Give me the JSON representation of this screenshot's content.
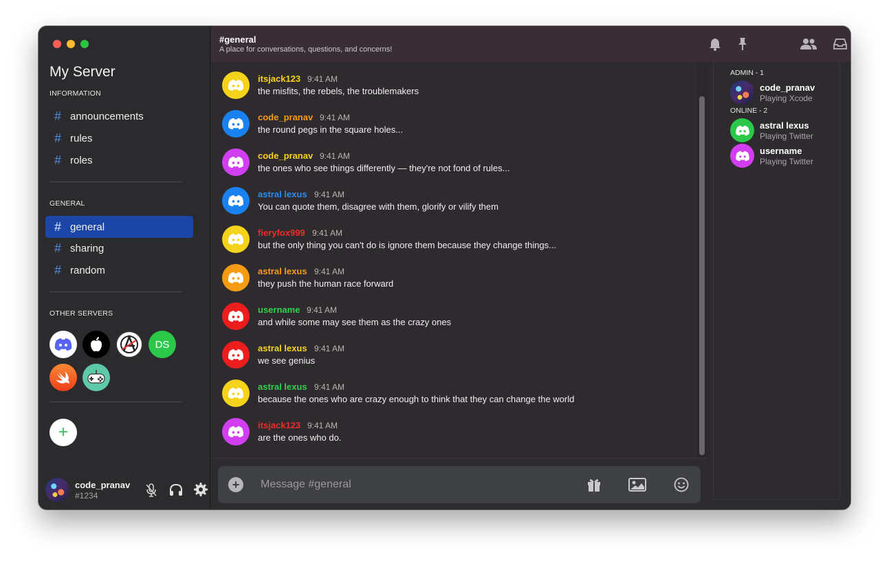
{
  "sidebar": {
    "server_name": "My Server",
    "sections": {
      "information": "INFORMATION",
      "general": "GENERAL",
      "other_servers": "OTHER SERVERS"
    },
    "info_channels": [
      "announcements",
      "rules",
      "roles"
    ],
    "general_channels": [
      "general",
      "sharing",
      "random"
    ],
    "active_channel": "general",
    "hash": "#",
    "other_servers": [
      {
        "icon": "discord-logo-icon",
        "bg": "#ffffff"
      },
      {
        "icon": "apple-logo-icon",
        "bg": "#000000"
      },
      {
        "icon": "anarchy-logo-icon",
        "bg": "#ffffff"
      },
      {
        "label": "DS",
        "bg": "#2bc84a"
      },
      {
        "icon": "swift-logo-icon",
        "bg": "#f0541e"
      },
      {
        "icon": "gamepad-icon",
        "bg": "#5dc9a7"
      }
    ],
    "add_server_label": "+",
    "user": {
      "name": "code_pranav",
      "tag": "#1234"
    }
  },
  "header": {
    "channel_title": "#general",
    "topic": "A place for conversations, questions, and concerns!",
    "icons": [
      "bell-icon",
      "pin-icon",
      "members-icon",
      "inbox-icon",
      "help-icon"
    ]
  },
  "messages": [
    {
      "author": "itsjack123",
      "author_color": "#f7d31b",
      "avatar_color": "#f5d31a",
      "time": "9:41 AM",
      "text": "the misfits, the rebels, the troublemakers"
    },
    {
      "author": "code_pranav",
      "author_color": "#f59b14",
      "avatar_color": "#1a82f0",
      "time": "9:41 AM",
      "text": "the round pegs in the square holes..."
    },
    {
      "author": "code_pranav",
      "author_color": "#f7d31b",
      "avatar_color": "#d13ff0",
      "time": "9:41 AM",
      "text": "the ones who see things differently — they're not fond of rules..."
    },
    {
      "author": "astral lexus",
      "author_color": "#2b8af5",
      "avatar_color": "#1a82f0",
      "time": "9:41 AM",
      "text": "You can quote them, disagree with them, glorify or vilify them"
    },
    {
      "author": "fieryfox999",
      "author_color": "#f02b2b",
      "avatar_color": "#f5d31a",
      "time": "9:41 AM",
      "text": "but the only thing you can't do is ignore them because they change things..."
    },
    {
      "author": "astral lexus",
      "author_color": "#f59b14",
      "avatar_color": "#f59b14",
      "time": "9:41 AM",
      "text": "they push the human race forward"
    },
    {
      "author": "username",
      "author_color": "#2fd14e",
      "avatar_color": "#ee1d1d",
      "time": "9:41 AM",
      "text": "and while some may see them as the crazy ones"
    },
    {
      "author": "astral lexus",
      "author_color": "#f7d31b",
      "avatar_color": "#ee1d1d",
      "time": "9:41 AM",
      "text": "we see genius"
    },
    {
      "author": "astral lexus",
      "author_color": "#2fd14e",
      "avatar_color": "#f5d31a",
      "time": "9:41 AM",
      "text": "because the ones who are crazy enough to think that they can change the world"
    },
    {
      "author": "itsjack123",
      "author_color": "#f02b2b",
      "avatar_color": "#d13ff0",
      "time": "9:41 AM",
      "text": "are the ones who do."
    }
  ],
  "composer": {
    "placeholder": "Message #general",
    "icons": [
      "gift-icon",
      "image-icon",
      "emoji-icon"
    ]
  },
  "members": {
    "groups": [
      {
        "label": "ADMIN - 1",
        "members": [
          {
            "name": "code_pranav",
            "status": "Playing Xcode",
            "avatar": "photo"
          }
        ]
      },
      {
        "label": "ONLINE - 2",
        "members": [
          {
            "name": "astral lexus",
            "status": "Playing Twitter",
            "avatar_color": "#2bc84a"
          },
          {
            "name": "username",
            "status": "Playing Twitter",
            "avatar_color": "#d13ff0"
          }
        ]
      }
    ]
  },
  "colors": {
    "accent": "#1c45a8",
    "hash": "#4a8ee8",
    "header": "#3a2e36"
  }
}
